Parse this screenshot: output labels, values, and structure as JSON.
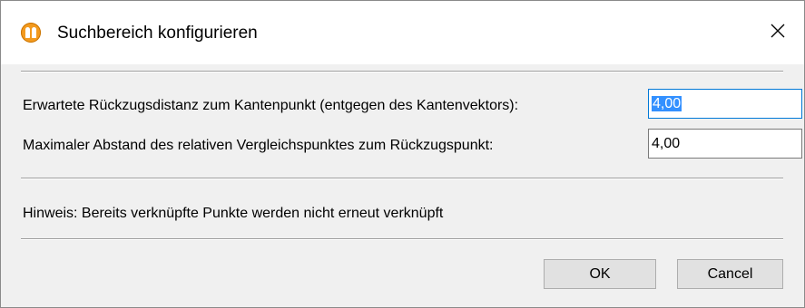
{
  "window": {
    "title": "Suchbereich konfigurieren",
    "app_icon": "app-logo-icon",
    "close_icon": "close-icon"
  },
  "form": {
    "retreat_distance_label": "Erwartete Rückzugsdistanz zum Kantenpunkt (entgegen des Kantenvektors):",
    "retreat_distance_value": "4,00",
    "max_distance_label": "Maximaler Abstand des relativen Vergleichspunktes zum Rückzugspunkt:",
    "max_distance_value": "4,00",
    "hint": "Hinweis: Bereits verknüpfte Punkte werden nicht erneut verknüpft"
  },
  "buttons": {
    "ok": "OK",
    "cancel": "Cancel"
  },
  "colors": {
    "app_icon": "#f39a1e",
    "selection": "#3390ff",
    "focus_border": "#0078d7"
  }
}
